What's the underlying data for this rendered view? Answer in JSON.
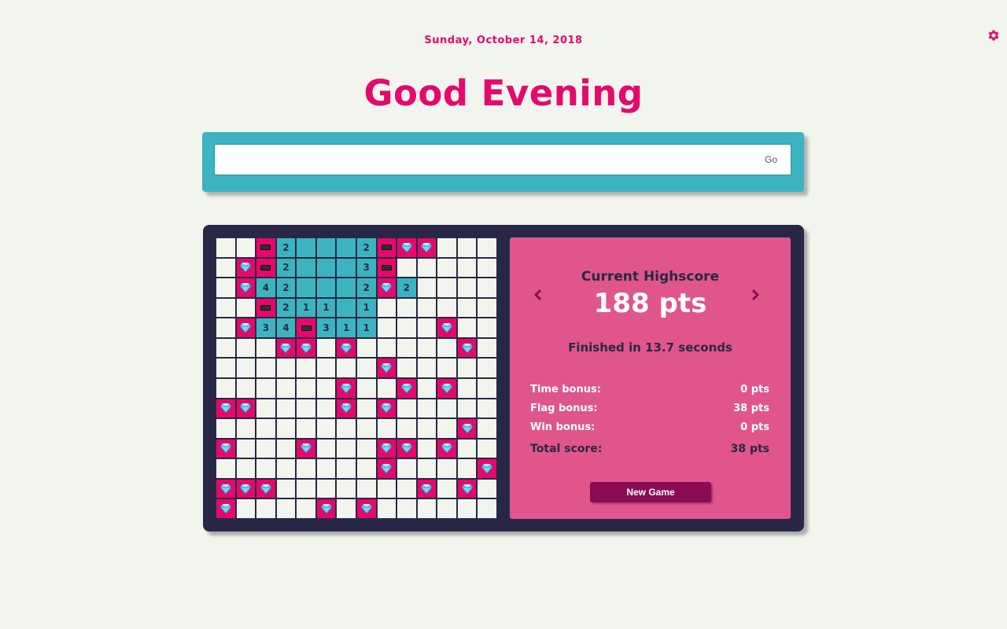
{
  "header": {
    "date": "Sunday, October 14, 2018",
    "greeting": "Good Evening",
    "settings_icon": "gear-icon"
  },
  "search": {
    "value": "",
    "placeholder": "",
    "go_label": "Go"
  },
  "colors": {
    "background": "#f2f5ee",
    "accent": "#e7086a",
    "search_frame": "#3cb4bf",
    "game_panel": "#282846",
    "score_panel": "#e0558c",
    "button": "#8a0d52"
  },
  "minesweeper": {
    "cell_legend": {
      "h": "hidden",
      "o": "opened empty",
      "m": "gem",
      "f": "flag",
      "digit": "opened with adjacent count"
    },
    "rows": [
      [
        "h",
        "h",
        "f",
        "2",
        "o",
        "o",
        "o",
        "2",
        "f",
        "m",
        "m",
        "h",
        "h",
        "h"
      ],
      [
        "h",
        "m",
        "f",
        "2",
        "o",
        "o",
        "o",
        "3",
        "f",
        "h",
        "h",
        "h",
        "h",
        "h"
      ],
      [
        "h",
        "m",
        "4",
        "2",
        "o",
        "o",
        "o",
        "2",
        "m",
        "2",
        "h",
        "h",
        "h",
        "h"
      ],
      [
        "h",
        "h",
        "f",
        "2",
        "1",
        "1",
        "o",
        "1",
        "h",
        "h",
        "h",
        "h",
        "h",
        "h"
      ],
      [
        "h",
        "m",
        "3",
        "4",
        "f",
        "3",
        "1",
        "1",
        "h",
        "h",
        "h",
        "m",
        "h",
        "h"
      ],
      [
        "h",
        "h",
        "h",
        "m",
        "m",
        "h",
        "m",
        "h",
        "h",
        "h",
        "h",
        "h",
        "m",
        "h"
      ],
      [
        "h",
        "h",
        "h",
        "h",
        "h",
        "h",
        "h",
        "h",
        "m",
        "h",
        "h",
        "h",
        "h",
        "h"
      ],
      [
        "h",
        "h",
        "h",
        "h",
        "h",
        "h",
        "m",
        "h",
        "h",
        "m",
        "h",
        "m",
        "h",
        "h"
      ],
      [
        "m",
        "m",
        "h",
        "h",
        "h",
        "h",
        "m",
        "h",
        "m",
        "h",
        "h",
        "h",
        "h",
        "h"
      ],
      [
        "h",
        "h",
        "h",
        "h",
        "h",
        "h",
        "h",
        "h",
        "h",
        "h",
        "h",
        "h",
        "m",
        "h"
      ],
      [
        "m",
        "h",
        "h",
        "h",
        "m",
        "h",
        "h",
        "h",
        "m",
        "m",
        "h",
        "m",
        "h",
        "h"
      ],
      [
        "h",
        "h",
        "h",
        "h",
        "h",
        "h",
        "h",
        "h",
        "m",
        "h",
        "h",
        "h",
        "h",
        "m"
      ],
      [
        "m",
        "m",
        "m",
        "h",
        "h",
        "h",
        "h",
        "h",
        "h",
        "h",
        "m",
        "h",
        "m",
        "h"
      ],
      [
        "m",
        "h",
        "h",
        "h",
        "h",
        "m",
        "h",
        "m",
        "h",
        "h",
        "h",
        "h",
        "h",
        "h"
      ]
    ]
  },
  "highscore": {
    "title": "Current Highscore",
    "prev_icon": "chevron-left-icon",
    "next_icon": "chevron-right-icon",
    "points": "188 pts",
    "finished": "Finished in 13.7 seconds",
    "time_bonus_label": "Time bonus:",
    "time_bonus_value": "0 pts",
    "flag_bonus_label": "Flag bonus:",
    "flag_bonus_value": "38 pts",
    "win_bonus_label": "Win bonus:",
    "win_bonus_value": "0 pts",
    "total_label": "Total score:",
    "total_value": "38 pts",
    "new_game_label": "New Game"
  }
}
